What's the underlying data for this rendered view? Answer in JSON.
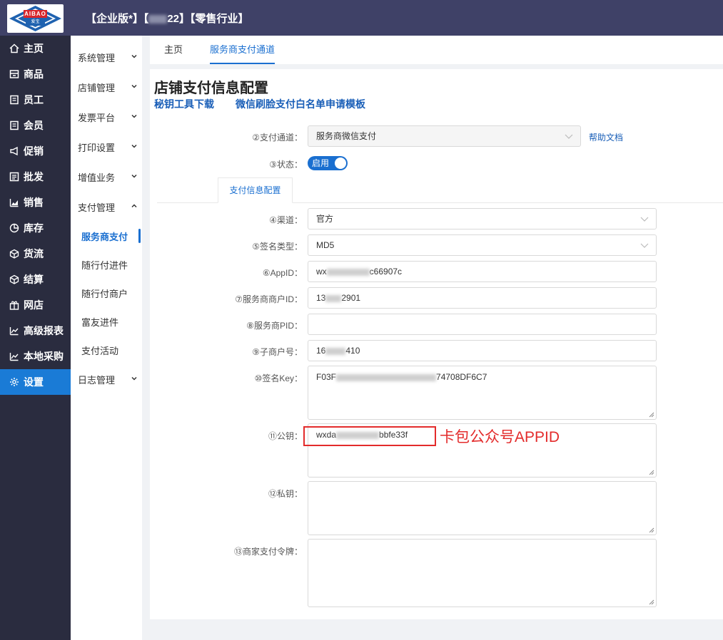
{
  "header": {
    "logo_text": "AIBAO",
    "logo_sub": "爱宝",
    "title_prefix": "【企业版*】【",
    "title_suffix": "22】【零售行业】"
  },
  "sidebar": {
    "items": [
      {
        "label": "主页",
        "icon": "home-icon"
      },
      {
        "label": "商品",
        "icon": "goods-icon"
      },
      {
        "label": "员工",
        "icon": "staff-icon"
      },
      {
        "label": "会员",
        "icon": "member-icon"
      },
      {
        "label": "促销",
        "icon": "promo-icon"
      },
      {
        "label": "批发",
        "icon": "wholesale-icon"
      },
      {
        "label": "销售",
        "icon": "sales-chart-icon"
      },
      {
        "label": "库存",
        "icon": "pie-icon"
      },
      {
        "label": "货流",
        "icon": "cube-icon"
      },
      {
        "label": "结算",
        "icon": "cube-icon"
      },
      {
        "label": "网店",
        "icon": "gift-icon"
      },
      {
        "label": "高级报表",
        "icon": "line-chart-icon"
      },
      {
        "label": "本地采购",
        "icon": "line-chart-icon"
      },
      {
        "label": "设置",
        "icon": "gear-icon",
        "active": true
      }
    ]
  },
  "submenu": {
    "groups": [
      "系统管理",
      "店铺管理",
      "发票平台",
      "打印设置",
      "增值业务",
      "支付管理"
    ],
    "children": [
      "服务商支付",
      "随行付进件",
      "随行付商户",
      "富友进件",
      "支付活动"
    ],
    "last_group": "日志管理"
  },
  "tabs": [
    "主页",
    "服务商支付通道"
  ],
  "page": {
    "title": "店铺支付信息配置",
    "link_keytool": "秘钥工具下载",
    "link_whitelist": "微信刷脸支付白名单申请模板"
  },
  "form": {
    "channel_label": "②支付通道：",
    "channel_value": "服务商微信支付",
    "help_link": "帮助文档",
    "status_label": "③状态：",
    "status_value": "启用",
    "subtab": "支付信息配置",
    "route_label": "④渠道：",
    "route_value": "官方",
    "sign_type_label": "⑤签名类型：",
    "sign_type_value": "MD5",
    "appid_label": "⑥AppID：",
    "appid_start": "wx",
    "appid_end": "c66907c",
    "mchid_label": "⑦服务商商户ID：",
    "mchid_start": "13",
    "mchid_end": "2901",
    "pid_label": "⑧服务商PID：",
    "pid_value": "",
    "sub_mch_label": "⑨子商户号：",
    "sub_mch_start": "16",
    "sub_mch_end": "410",
    "sign_key_label": "⑩签名Key：",
    "sign_key_start": "F03F",
    "sign_key_end": "74708DF6C7",
    "pubkey_label": "⑪公钥：",
    "pubkey_start": "wxda",
    "pubkey_end": "bbfe33f",
    "privkey_label": "⑫私钥：",
    "privkey_value": "",
    "token_label": "⑬商家支付令牌：",
    "token_value": ""
  },
  "annotation": {
    "text": "卡包公众号APPID",
    "color": "#e32b2b"
  },
  "colors": {
    "topbar": "#3f4167",
    "sidebar": "#2a2c3f",
    "accent": "#1a6fd0"
  }
}
